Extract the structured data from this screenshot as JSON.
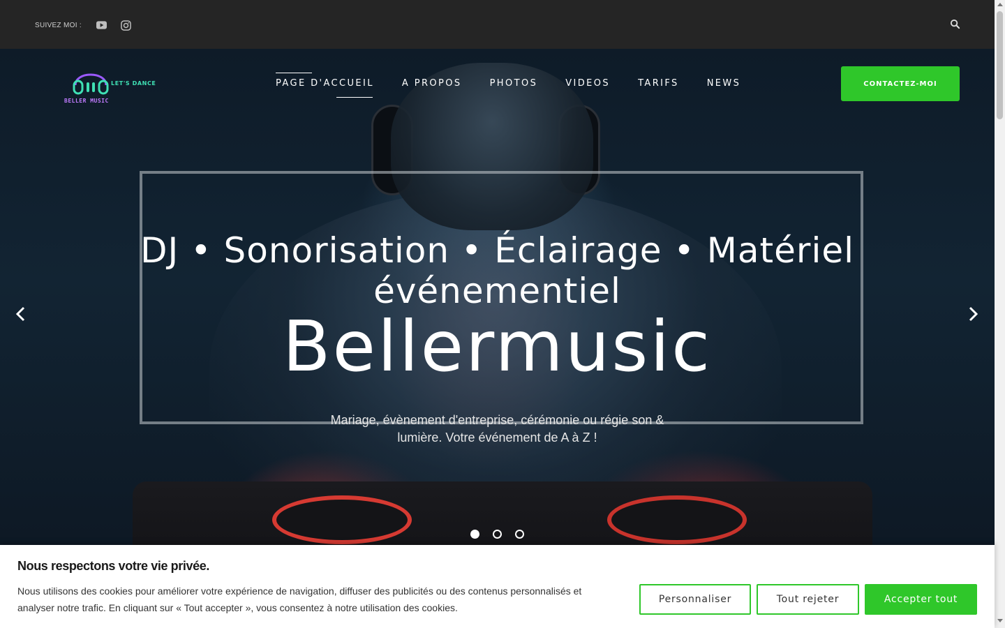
{
  "topbar": {
    "follow_label": "SUIVEZ MOI :",
    "social": [
      "youtube-icon",
      "instagram-icon"
    ],
    "search_icon": "search-icon"
  },
  "logo": {
    "tagline": "LET'S DANCE",
    "name": "BELLER MUSIC",
    "icon": "headphones-icon"
  },
  "nav": {
    "items": [
      {
        "label": "PAGE D'ACCUEIL",
        "active": true
      },
      {
        "label": "A PROPOS",
        "active": false
      },
      {
        "label": "PHOTOS",
        "active": false
      },
      {
        "label": "VIDEOS",
        "active": false
      },
      {
        "label": "TARIFS",
        "active": false
      },
      {
        "label": "NEWS",
        "active": false
      }
    ],
    "cta_label": "CONTACTEZ-MOI"
  },
  "hero": {
    "subtitle": "DJ • Sonorisation • Éclairage • Matériel événementiel",
    "title": "Bellermusic",
    "description": "Mariage, évènement d'entreprise, cérémonie ou régie son & lumière. Votre événement de A à Z !",
    "slides_count": 3,
    "active_slide": 1
  },
  "cookie": {
    "title": "Nous respectons votre vie privée.",
    "text": "Nous utilisons des cookies pour améliorer votre expérience de navigation, diffuser des publicités ou des contenus personnalisés et analyser notre trafic. En cliquant sur « Tout accepter », vous consentez à notre utilisation des cookies.",
    "customize_label": "Personnaliser",
    "reject_label": "Tout rejeter",
    "accept_label": "Accepter tout"
  },
  "colors": {
    "accent": "#2fc72a",
    "topbar_bg": "#252525",
    "logo_teal": "#3fe0b4",
    "logo_purple": "#c07bff"
  }
}
